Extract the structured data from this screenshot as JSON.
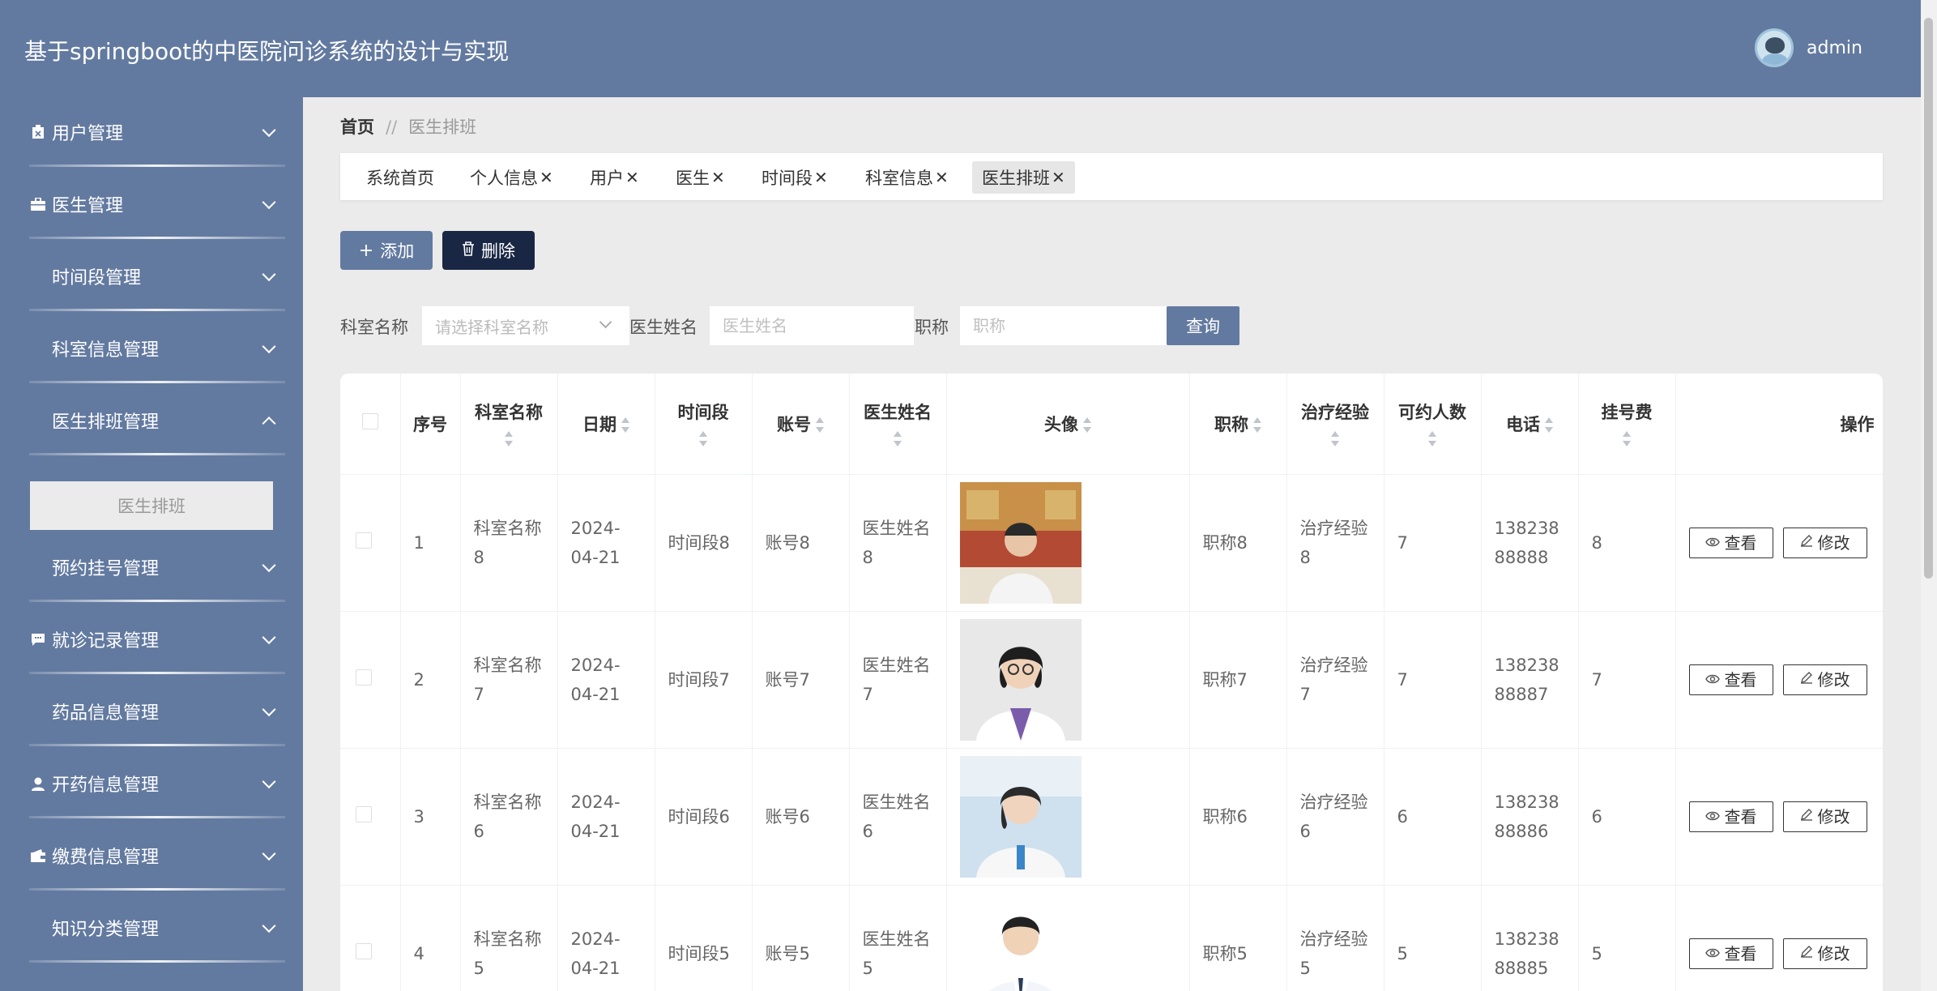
{
  "header": {
    "title": "基于springboot的中医院问诊系统的设计与实现",
    "user": "admin"
  },
  "sidebar": {
    "items": [
      {
        "label": "用户管理",
        "icon": "clipboard-icon"
      },
      {
        "label": "医生管理",
        "icon": "briefcase-icon"
      },
      {
        "label": "时间段管理",
        "icon": "grid-icon"
      },
      {
        "label": "科室信息管理",
        "icon": "grid-icon"
      },
      {
        "label": "医生排班管理",
        "icon": "grid-icon",
        "expanded": true
      },
      {
        "label": "预约挂号管理",
        "icon": "grid-icon"
      },
      {
        "label": "就诊记录管理",
        "icon": "chat-icon"
      },
      {
        "label": "药品信息管理",
        "icon": "grid-icon"
      },
      {
        "label": "开药信息管理",
        "icon": "person-icon"
      },
      {
        "label": "缴费信息管理",
        "icon": "wallet-icon"
      },
      {
        "label": "知识分类管理",
        "icon": "grid-icon"
      }
    ],
    "submenu": "医生排班"
  },
  "breadcrumb": {
    "home": "首页",
    "separator": "//",
    "current": "医生排班"
  },
  "tabs": [
    {
      "label": "系统首页"
    },
    {
      "label": "个人信息"
    },
    {
      "label": "用户"
    },
    {
      "label": "医生"
    },
    {
      "label": "时间段"
    },
    {
      "label": "科室信息"
    },
    {
      "label": "医生排班",
      "active": true
    }
  ],
  "actions": {
    "add": "添加",
    "delete": "删除"
  },
  "search": {
    "dept_label": "科室名称",
    "dept_placeholder": "请选择科室名称",
    "doctor_label": "医生姓名",
    "doctor_placeholder": "医生姓名",
    "title_label": "职称",
    "title_placeholder": "职称",
    "query": "查询"
  },
  "table": {
    "headers": {
      "index": "序号",
      "dept": "科室名称",
      "date": "日期",
      "slot": "时间段",
      "account": "账号",
      "doctor": "医生姓名",
      "avatar": "头像",
      "title": "职称",
      "experience": "治疗经验",
      "capacity": "可约人数",
      "phone": "电话",
      "fee": "挂号费",
      "ops": "操作"
    },
    "view_label": "查看",
    "edit_label": "修改",
    "rows": [
      {
        "index": "1",
        "dept": "科室名称8",
        "date": "2024-04-21",
        "slot": "时间段8",
        "account": "账号8",
        "doctor": "医生姓名8",
        "title": "职称8",
        "experience": "治疗经验8",
        "capacity": "7",
        "phone": "13823888888",
        "fee": "8"
      },
      {
        "index": "2",
        "dept": "科室名称7",
        "date": "2024-04-21",
        "slot": "时间段7",
        "account": "账号7",
        "doctor": "医生姓名7",
        "title": "职称7",
        "experience": "治疗经验7",
        "capacity": "7",
        "phone": "13823888887",
        "fee": "7"
      },
      {
        "index": "3",
        "dept": "科室名称6",
        "date": "2024-04-21",
        "slot": "时间段6",
        "account": "账号6",
        "doctor": "医生姓名6",
        "title": "职称6",
        "experience": "治疗经验6",
        "capacity": "6",
        "phone": "13823888886",
        "fee": "6"
      },
      {
        "index": "4",
        "dept": "科室名称5",
        "date": "2024-04-21",
        "slot": "时间段5",
        "account": "账号5",
        "doctor": "医生姓名5",
        "title": "职称5",
        "experience": "治疗经验5",
        "capacity": "5",
        "phone": "13823888885",
        "fee": "5"
      }
    ]
  }
}
